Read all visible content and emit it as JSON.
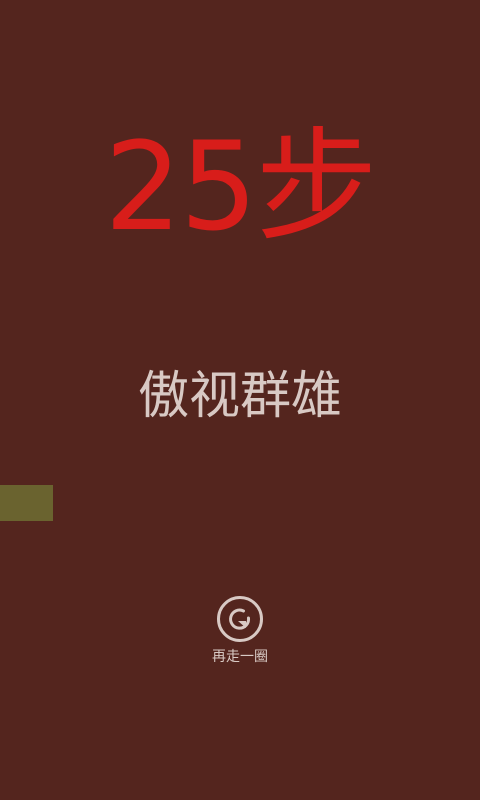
{
  "result": {
    "score_text": "25步",
    "rank_title": "傲视群雄"
  },
  "replay": {
    "label": "再走一圈",
    "icon": "replay-icon"
  },
  "colors": {
    "background": "#54251e",
    "score": "#d81d1a",
    "text": "#d8c9c4",
    "block": "#6a632f"
  }
}
